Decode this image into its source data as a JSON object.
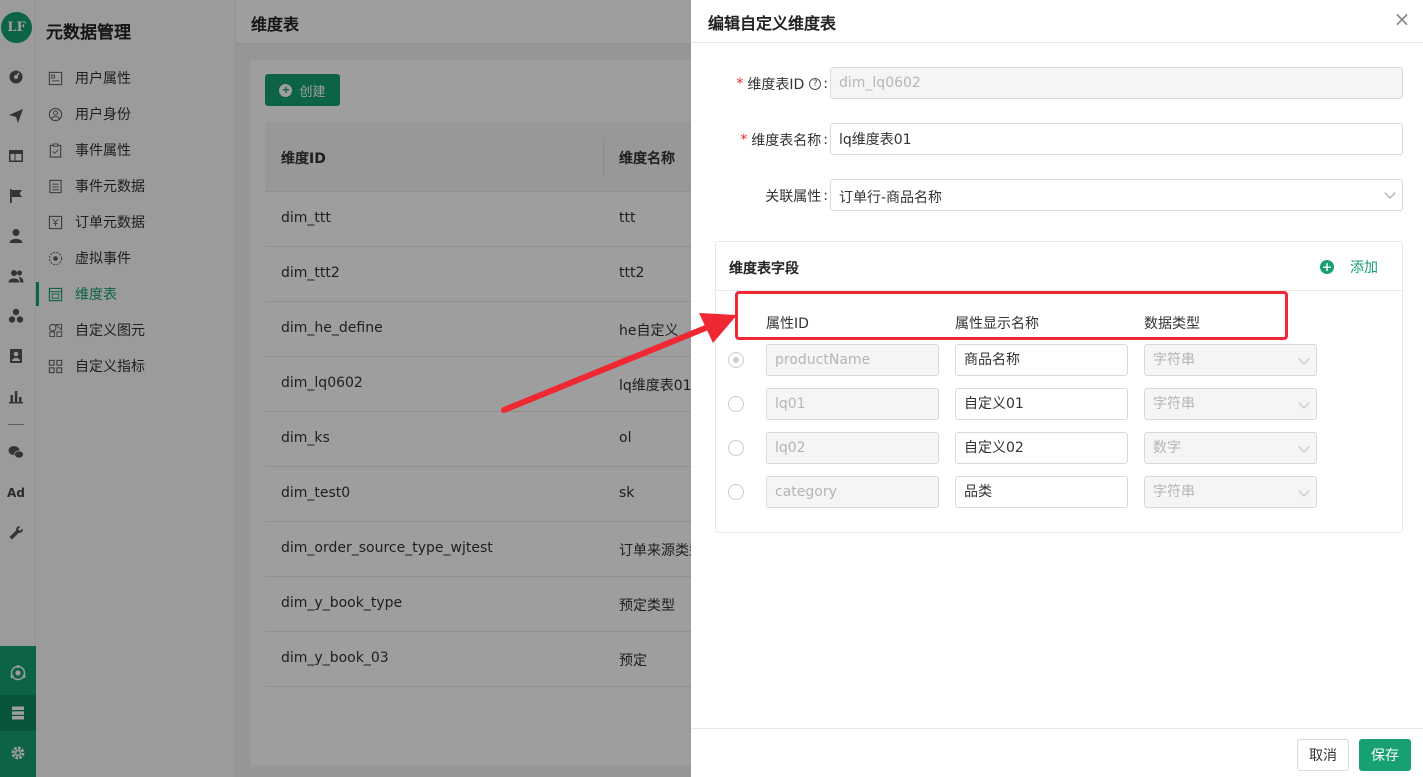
{
  "app": {
    "logo_text": "LF",
    "accent_color": "#16a073",
    "rail_icons": [
      "dashboard-icon",
      "send-icon",
      "layout-icon",
      "flag-icon",
      "user-icon",
      "users-icon",
      "cluster-icon",
      "portrait-icon",
      "bar-chart-icon",
      "wechat-icon",
      "ad-icon",
      "wrench-icon"
    ],
    "rail_ad_label": "Ad",
    "rail_bottom_icons": [
      "hub-icon",
      "database-icon",
      "settings-icon"
    ]
  },
  "menu": {
    "title": "元数据管理",
    "items": [
      {
        "label": "用户属性",
        "icon": "id-card-icon"
      },
      {
        "label": "用户身份",
        "icon": "user-circle-icon"
      },
      {
        "label": "事件属性",
        "icon": "clipboard-icon"
      },
      {
        "label": "事件元数据",
        "icon": "list-icon"
      },
      {
        "label": "订单元数据",
        "icon": "order-icon"
      },
      {
        "label": "虚拟事件",
        "icon": "virtual-icon"
      },
      {
        "label": "维度表",
        "icon": "table-icon",
        "active": true
      },
      {
        "label": "自定义图元",
        "icon": "shape-icon"
      },
      {
        "label": "自定义指标",
        "icon": "grid-icon"
      }
    ]
  },
  "page": {
    "title": "维度表",
    "create_label": "创建",
    "columns": [
      "维度ID",
      "维度名称"
    ],
    "rows": [
      {
        "id": "dim_ttt",
        "name": "ttt"
      },
      {
        "id": "dim_ttt2",
        "name": "ttt2"
      },
      {
        "id": "dim_he_define",
        "name": "he自定义"
      },
      {
        "id": "dim_lq0602",
        "name": "lq维度表01"
      },
      {
        "id": "dim_ks",
        "name": "ol"
      },
      {
        "id": "dim_test0",
        "name": "sk"
      },
      {
        "id": "dim_order_source_type_wjtest",
        "name": "订单来源类型"
      },
      {
        "id": "dim_y_book_type",
        "name": "预定类型"
      },
      {
        "id": "dim_y_book_03",
        "name": "预定"
      }
    ]
  },
  "drawer": {
    "title": "编辑自定义维度表",
    "form": {
      "table_id_label": "维度表ID",
      "table_id_value": "dim_lq0602",
      "table_name_label": "维度表名称",
      "table_name_value": "lq维度表01",
      "relation_label": "关联属性",
      "relation_value": "订单行-商品名称",
      "colon": ":"
    },
    "fields": {
      "title": "维度表字段",
      "add_label": "添加",
      "col_id": "属性ID",
      "col_name": "属性显示名称",
      "col_type": "数据类型",
      "rows": [
        {
          "id": "productName",
          "name": "商品名称",
          "type": "字符串",
          "primary": true
        },
        {
          "id": "lq01",
          "name": "自定义01",
          "type": "字符串",
          "primary": false
        },
        {
          "id": "lq02",
          "name": "自定义02",
          "type": "数字",
          "primary": false
        },
        {
          "id": "category",
          "name": "品类",
          "type": "字符串",
          "primary": false
        }
      ]
    },
    "cancel_label": "取消",
    "save_label": "保存"
  },
  "annotation": {
    "color": "#f02833"
  }
}
